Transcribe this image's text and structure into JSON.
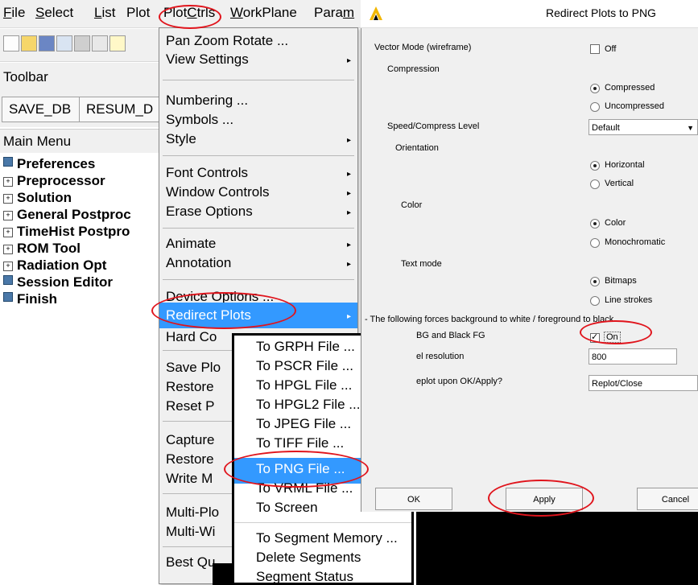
{
  "menubar": {
    "items": [
      {
        "label": "File",
        "ul": "F",
        "rest": "ile"
      },
      {
        "label": "Select",
        "ul": "S",
        "rest": "elect"
      },
      {
        "label": "List",
        "ul": "L",
        "rest": "ist"
      },
      {
        "label": "Plot",
        "ul": "",
        "rest": "Plot"
      },
      {
        "label": "PlotCtrls",
        "pre": "Plot",
        "ul": "C",
        "rest": "trls"
      },
      {
        "label": "WorkPlane",
        "ul": "W",
        "rest": "orkPlane"
      },
      {
        "label": "Param",
        "pre": "Para",
        "ul": "m",
        "rest": ""
      }
    ]
  },
  "toolbar": {
    "header": "Toolbar",
    "buttons": [
      "SAVE_DB",
      "RESUM_D"
    ],
    "icons": [
      "new-file-icon",
      "open-folder-icon",
      "save-icon",
      "report-icon",
      "print-icon",
      "image-icon",
      "help-icon"
    ]
  },
  "main_menu": {
    "header": "Main Menu",
    "items": [
      {
        "label": "Preferences",
        "box": "filled"
      },
      {
        "label": "Preprocessor",
        "box": "plus"
      },
      {
        "label": "Solution",
        "box": "plus"
      },
      {
        "label": "General Postproc",
        "box": "plus"
      },
      {
        "label": "TimeHist Postpro",
        "box": "plus"
      },
      {
        "label": "ROM Tool",
        "box": "plus"
      },
      {
        "label": "Radiation Opt",
        "box": "plus"
      },
      {
        "label": "Session Editor",
        "box": "filled"
      },
      {
        "label": "Finish",
        "box": "filled"
      }
    ]
  },
  "plotctrls_menu": {
    "items": [
      {
        "label": "Pan Zoom Rotate ...",
        "arrow": false
      },
      {
        "label": "View Settings",
        "arrow": true
      },
      {
        "label": "Numbering ...",
        "arrow": false
      },
      {
        "label": "Symbols ...",
        "arrow": false
      },
      {
        "label": "Style",
        "arrow": true
      },
      {
        "label": "Font Controls",
        "arrow": true
      },
      {
        "label": "Window Controls",
        "arrow": true
      },
      {
        "label": "Erase Options",
        "arrow": true
      },
      {
        "label": "Animate",
        "arrow": true
      },
      {
        "label": "Annotation",
        "arrow": true
      },
      {
        "label": "Device Options ...",
        "arrow": false
      },
      {
        "label": "Redirect Plots",
        "arrow": true,
        "highlighted": true
      },
      {
        "label": "Hard Co",
        "arrow": false
      },
      {
        "label": "Save Plo",
        "arrow": false
      },
      {
        "label": "Restore",
        "arrow": false
      },
      {
        "label": "Reset P",
        "arrow": false
      },
      {
        "label": "Capture",
        "arrow": false
      },
      {
        "label": "Restore",
        "arrow": false
      },
      {
        "label": "Write M",
        "arrow": false
      },
      {
        "label": "Multi-Plo",
        "arrow": false
      },
      {
        "label": "Multi-Wi",
        "arrow": false
      },
      {
        "label": "Best Qu",
        "arrow": false
      }
    ]
  },
  "redirect_submenu": {
    "items": [
      "To GRPH File ...",
      "To PSCR File ...",
      "To HPGL File ...",
      "To HPGL2 File ...",
      "To JPEG File ...",
      "To TIFF File ...",
      "To PNG File ...",
      "To VRML File ...",
      "To Screen",
      "To Segment Memory ...",
      "Delete Segments",
      "Segment Status"
    ],
    "highlighted_index": 6
  },
  "dialog": {
    "title": "Redirect Plots to PNG",
    "vector_mode_label": "Vector Mode (wireframe)",
    "vector_mode_value": "Off",
    "compression_label": "Compression",
    "compression_options": [
      "Compressed",
      "Uncompressed"
    ],
    "speed_label": "Speed/Compress Level",
    "speed_value": "Default",
    "orientation_label": "Orientation",
    "orientation_options": [
      "Horizontal",
      "Vertical"
    ],
    "color_label": "Color",
    "color_options": [
      "Color",
      "Monochromatic"
    ],
    "text_mode_label": "Text mode",
    "text_mode_options": [
      "Bitmaps",
      "Line strokes"
    ],
    "force_note": "- The following forces background to white / foreground to black",
    "bg_label": "BG and Black FG",
    "bg_value": "On",
    "resolution_label": "el resolution",
    "resolution_value": "800",
    "replot_label": "eplot upon OK/Apply?",
    "replot_value": "Replot/Close",
    "buttons": {
      "ok": "OK",
      "apply": "Apply",
      "cancel": "Cancel"
    }
  },
  "colors": {
    "highlight": "#3399ff",
    "annotation": "#e0141c",
    "menu_bg": "#f0f0f0"
  }
}
